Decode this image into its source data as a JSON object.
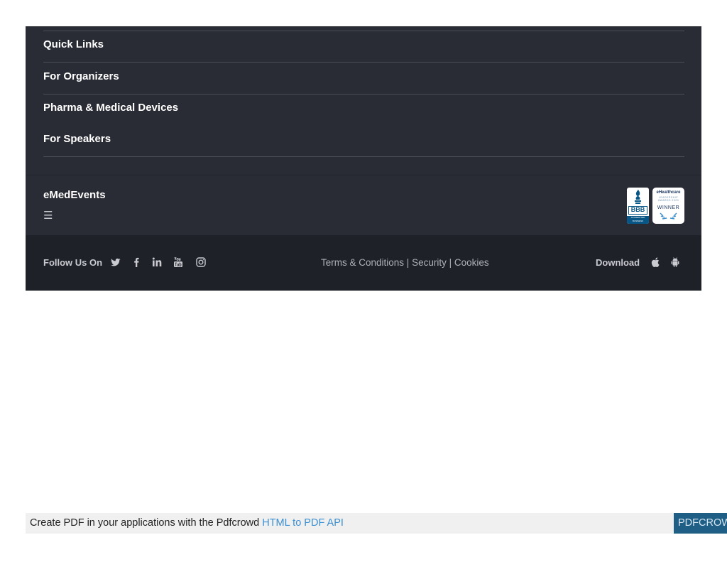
{
  "footer_links": {
    "items": [
      {
        "label": "Quick Links"
      },
      {
        "label": "For Organizers"
      },
      {
        "label": "Pharma & Medical Devices"
      },
      {
        "label": "For Speakers"
      }
    ]
  },
  "brand": {
    "name": "eMedEvents",
    "menu_icon": "hamburger-menu-icon",
    "menu_glyph": "☰",
    "badges": {
      "bbb_mark": "BBB",
      "bbb_footer": "ACCREDITED BUSINESS",
      "award_line1": "eHealthcare",
      "award_line2": "LEADERSHIP AWARDS 2020",
      "award_line3": "WINNER"
    }
  },
  "bottom_bar": {
    "follow_label": "Follow Us On",
    "social_icons": [
      "twitter-icon",
      "facebook-icon",
      "linkedin-icon",
      "youtube-icon",
      "instagram-icon"
    ],
    "legal": {
      "terms": "Terms & Conditions",
      "security": "Security",
      "cookies": "Cookies",
      "separator": " | "
    },
    "download_label": "Download",
    "download_icons": [
      "apple-icon",
      "android-icon"
    ]
  },
  "pdf_banner": {
    "text": "Create PDF in your applications with the Pdfcrowd ",
    "link": "HTML to PDF API",
    "brand": "PDFCROWD"
  },
  "colors": {
    "footer_bg": "#2a2c35",
    "bottom_bar_bg": "#1f2128",
    "link_accent": "#3d8fd1",
    "pdf_brand_bg": "#1f5f86"
  }
}
